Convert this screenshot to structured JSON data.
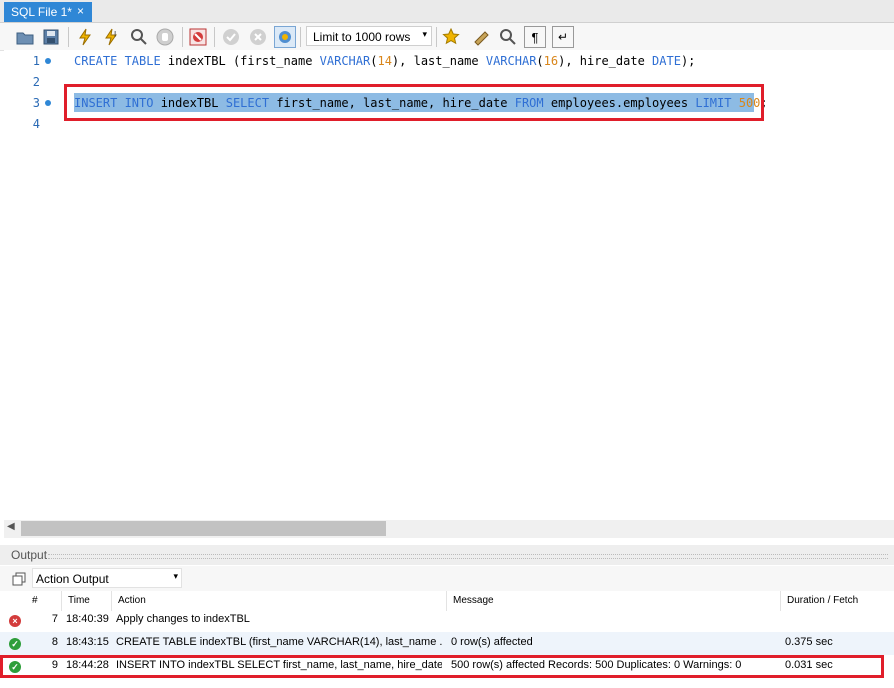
{
  "tab": {
    "label": "SQL File 1*",
    "close": "×"
  },
  "toolbar": {
    "limit_value": "Limit to 1000 rows",
    "limit_arrow": "▾"
  },
  "editor": {
    "lines": [
      {
        "num": "1",
        "has_dot": true
      },
      {
        "num": "2",
        "has_dot": false
      },
      {
        "num": "3",
        "has_dot": true
      },
      {
        "num": "4",
        "has_dot": false
      }
    ]
  },
  "output": {
    "title": "Output",
    "select_value": "Action Output",
    "select_arrow": "▾",
    "columns": [
      "#",
      "Time",
      "Action",
      "Message",
      "Duration / Fetch"
    ],
    "rows": [
      {
        "status": "error",
        "num": "7",
        "time": "18:40:39",
        "action": "Apply changes to indexTBL",
        "message": "",
        "duration": ""
      },
      {
        "status": "ok",
        "num": "8",
        "time": "18:43:15",
        "action": "CREATE TABLE indexTBL (first_name VARCHAR(14), last_name ...",
        "message": "0 row(s) affected",
        "duration": "0.375 sec"
      },
      {
        "status": "ok",
        "num": "9",
        "time": "18:44:28",
        "action": "INSERT INTO indexTBL SELECT first_name, last_name, hire_date...",
        "message": "500 row(s) affected Records: 500  Duplicates: 0  Warnings: 0",
        "duration": "0.031 sec"
      }
    ]
  },
  "colors": {
    "accent": "#2f87d6",
    "highlight_box": "#e01e2a",
    "keyword": "#2f6fd4",
    "number": "#d9861b",
    "ok": "#2e9e3a",
    "error": "#d33c3c"
  }
}
